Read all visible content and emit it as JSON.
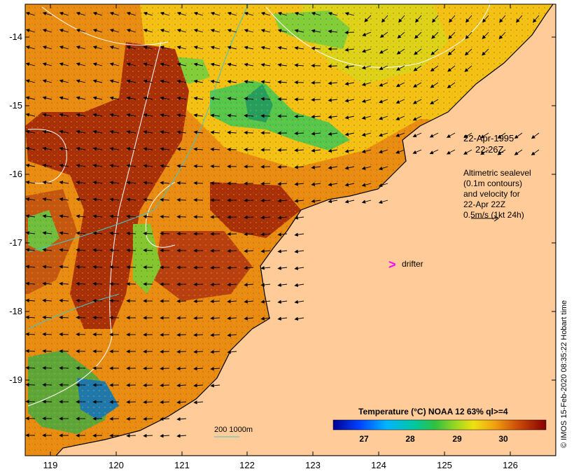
{
  "map": {
    "y_ticks": [
      "-14",
      "-15",
      "-16",
      "-17",
      "-18",
      "-19"
    ],
    "x_ticks": [
      "119",
      "120",
      "121",
      "122",
      "123",
      "124",
      "125",
      "126"
    ],
    "lat_range": [
      -20.1,
      -13.6
    ],
    "lon_range": [
      118.6,
      126.7
    ]
  },
  "annotations": {
    "date": "22-Apr-1995",
    "time": "22:26Z",
    "legend_lines": [
      "Altimetric sealevel",
      "(0.1m contours)",
      "and velocity for",
      "22-Apr 22Z",
      "0.5m/s (1kt 24h)"
    ],
    "drifter_label": "drifter",
    "drifter_marker": ">",
    "depth_legend": "200  1000m"
  },
  "colorbar": {
    "title": "Temperature (°C) NOAA 12 63% ql>=4",
    "ticks": [
      "27",
      "28",
      "29",
      "30"
    ],
    "range": [
      26.4,
      30.9
    ]
  },
  "credit": "© IMOS 15-Feb-2020 08:35:22 Hobart time",
  "colors": {
    "land": "#ffcc99",
    "warm": "#a82c08",
    "mid": "#e68a10",
    "cool": "#f2c414",
    "green": "#4fc64a",
    "drifter": "#ff00ff",
    "contour": "#ffffff",
    "bathy": "#40c8c8"
  }
}
